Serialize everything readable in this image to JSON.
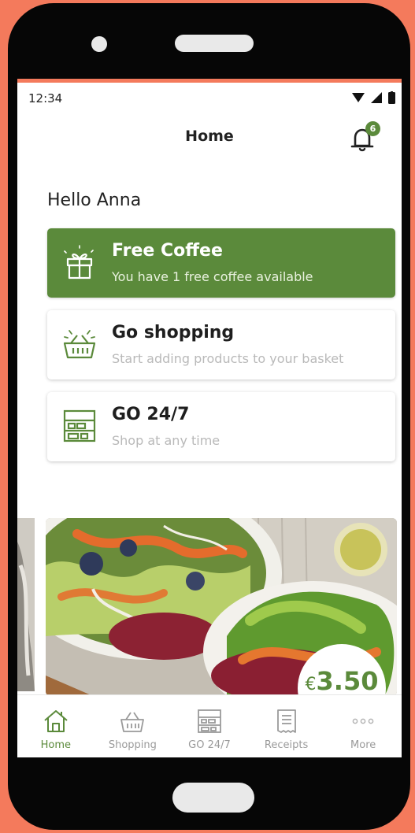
{
  "status_bar": {
    "time": "12:34"
  },
  "header": {
    "title": "Home",
    "notification_count": "6"
  },
  "greeting": "Hello Anna",
  "cards": [
    {
      "title": "Free Coffee",
      "subtitle": "You have 1 free coffee available",
      "icon": "gift-icon",
      "highlighted": true
    },
    {
      "title": "Go shopping",
      "subtitle": "Start adding products to your basket",
      "icon": "basket-icon",
      "highlighted": false
    },
    {
      "title": "GO 24/7",
      "subtitle": "Shop at any time",
      "icon": "store-shelf-icon",
      "highlighted": false
    }
  ],
  "promo": {
    "currency": "€",
    "price": "3.50"
  },
  "bottom_nav": [
    {
      "label": "Home",
      "icon": "home-icon",
      "active": true
    },
    {
      "label": "Shopping",
      "icon": "basket-icon",
      "active": false
    },
    {
      "label": "GO 24/7",
      "icon": "store-shelf-icon",
      "active": false
    },
    {
      "label": "Receipts",
      "icon": "receipt-icon",
      "active": false
    },
    {
      "label": "More",
      "icon": "more-dots-icon",
      "active": false
    }
  ],
  "colors": {
    "brand_green": "#5b8a3b",
    "frame_accent": "#f47a5c",
    "inactive_gray": "#9a9a9a"
  }
}
